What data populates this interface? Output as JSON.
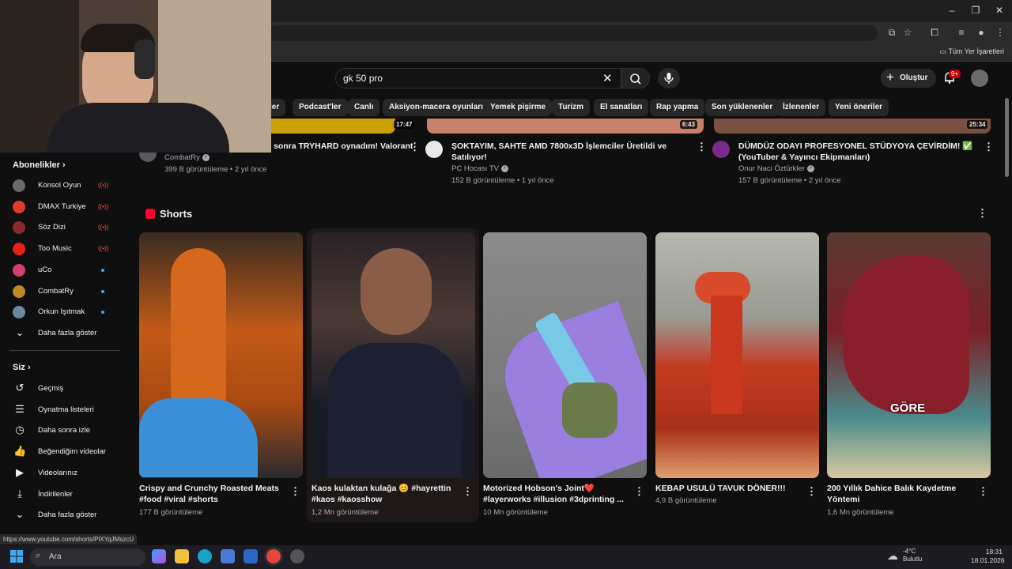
{
  "browser": {
    "bookmarks_all": "Tüm Yer İşaretleri"
  },
  "header": {
    "search_value": "gk 50 pro",
    "create_label": "Oluştur",
    "notification_badge": "9+"
  },
  "chips": [
    "ler",
    "Podcast'ler",
    "Canlı",
    "Aksiyon-macera oyunları",
    "Yemek pişirme",
    "Turizm",
    "El sanatları",
    "Rap yapma",
    "Son yüklenenler",
    "İzlenenler",
    "Yeni öneriler"
  ],
  "sidebar": {
    "subs_title": "Abonelikler",
    "subs": [
      {
        "label": "Konsol Oyun",
        "indicator": "live",
        "color": "#6a6a6a"
      },
      {
        "label": "DMAX Turkiye",
        "indicator": "live",
        "color": "#e03a2c"
      },
      {
        "label": "Söz Dizi",
        "indicator": "live",
        "color": "#8a2a2a"
      },
      {
        "label": "Too Music",
        "indicator": "live",
        "color": "#e62117"
      },
      {
        "label": "uCo",
        "indicator": "dot",
        "color": "#d04070"
      },
      {
        "label": "CombatRy",
        "indicator": "dot",
        "color": "#c08a2a"
      },
      {
        "label": "Orkun Işıtmak",
        "indicator": "dot",
        "color": "#6a8aa0"
      }
    ],
    "show_more": "Daha fazla göster",
    "you_title": "Siz",
    "you_items": [
      {
        "label": "Geçmiş",
        "icon": "history-icon",
        "glyph": "↺"
      },
      {
        "label": "Oynatma listeleri",
        "icon": "playlists-icon",
        "glyph": "☰"
      },
      {
        "label": "Daha sonra izle",
        "icon": "clock-icon",
        "glyph": "◷"
      },
      {
        "label": "Beğendiğim videolar",
        "icon": "thumbs-up-icon",
        "glyph": "👍"
      },
      {
        "label": "Videolarınız",
        "icon": "video-icon",
        "glyph": "▶"
      },
      {
        "label": "İndirilenler",
        "icon": "download-icon",
        "glyph": "⤓"
      }
    ],
    "show_more2": "Daha fazla göster"
  },
  "videos": [
    {
      "title1": "sonra TRYHARD oynadım! Valorant",
      "title2": "",
      "channel": "CombatRy",
      "meta": "399 B görüntüleme • 2 yıl önce",
      "duration": "17:47",
      "thumb": "#c8a000"
    },
    {
      "title1": "ŞOKTAYIM, SAHTE AMD 7800x3D İşlemciler Üretildi ve",
      "title2": "Satılıyor!",
      "channel": "PC Hocası TV",
      "meta": "152 B görüntüleme • 1 yıl önce",
      "duration": "6:43",
      "thumb": "#c7806a"
    },
    {
      "title1": "DÜMDÜZ ODAYI PROFESYONEL STÜDYOYA ÇEVİRDİM! ✅",
      "title2": "(YouTuber & Yayıncı Ekipmanları)",
      "channel": "Onur Naci Öztürkler",
      "meta": "157 B görüntüleme • 2 yıl önce",
      "duration": "25:34",
      "thumb": "#7a5040"
    }
  ],
  "shorts": {
    "title": "Shorts",
    "items": [
      {
        "line1": "Crispy and Crunchy Roasted Meats",
        "line2": "#food #viral #shorts",
        "views": "177 B görüntüleme"
      },
      {
        "line1": "Kaos kulaktan kulağa 😊 #hayrettin",
        "line2": "#kaos #kaosshow",
        "views": "1,2 Mn görüntüleme"
      },
      {
        "line1": "Motorized Hobson's Joint❤️",
        "line2": "#layerworks #illusion #3dprinting ...",
        "views": "10 Mn görüntüleme"
      },
      {
        "line1": "KEBAP USULÜ TAVUK DÖNER!!!",
        "line2": "",
        "views": "4,9 B görüntüleme"
      },
      {
        "line1": "200 Yıllık Dahice Balık Kaydetme",
        "line2": "Yöntemi",
        "views": "1,6 Mn görüntüleme"
      }
    ],
    "overlay_text": "GÖRE"
  },
  "status_url": "https://www.youtube.com/shorts/PlXYqJMszcU",
  "taskbar": {
    "search": "Ara",
    "temp": "-4°C",
    "weather": "Bulutlu",
    "time": "18:31",
    "date": "18.01.2026"
  }
}
